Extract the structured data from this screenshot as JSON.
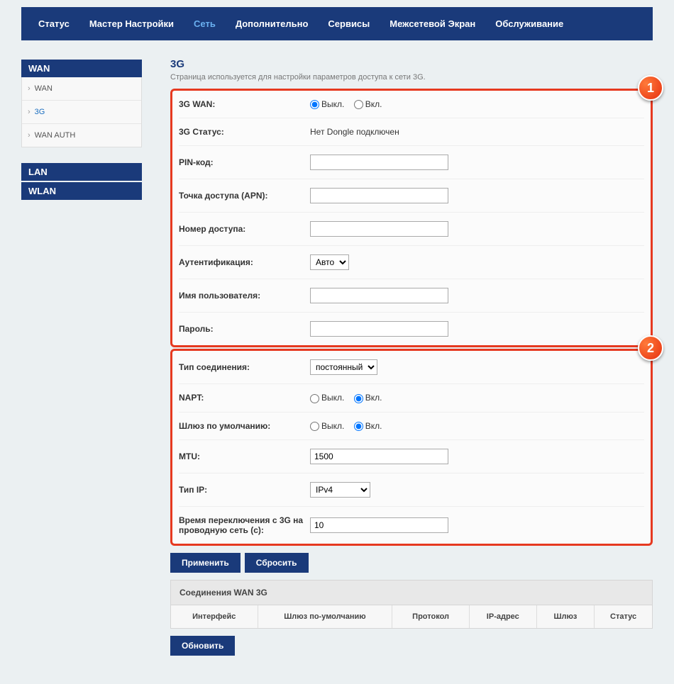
{
  "nav": {
    "items": [
      "Статус",
      "Мастер Настройки",
      "Сеть",
      "Дополнительно",
      "Сервисы",
      "Межсетевой Экран",
      "Обслуживание"
    ],
    "activeIndex": 2
  },
  "sidebar": {
    "groups": [
      {
        "title": "WAN",
        "items": [
          "WAN",
          "3G",
          "WAN AUTH"
        ],
        "activeIndex": 1
      },
      {
        "title": "LAN"
      },
      {
        "title": "WLAN"
      }
    ]
  },
  "page": {
    "title": "3G",
    "desc": "Страница используется для настройки параметров доступа к сети 3G."
  },
  "labels": {
    "wan3g": "3G WAN:",
    "status3g": "3G Статус:",
    "pin": "PIN-код:",
    "apn": "Точка доступа (APN):",
    "dialnum": "Номер доступа:",
    "auth": "Аутентификация:",
    "user": "Имя пользователя:",
    "pass": "Пароль:",
    "conntype": "Тип соединения:",
    "napt": "NAPT:",
    "defgw": "Шлюз по умолчанию:",
    "mtu": "MTU:",
    "iptype": "Тип IP:",
    "switchtime": "Время переключения с 3G на проводную сеть (с):"
  },
  "values": {
    "status3g": "Нет Dongle подключен",
    "radio_off": "Выкл.",
    "radio_on": "Вкл.",
    "pin": "",
    "apn": "",
    "dialnum": "",
    "auth": "Авто",
    "user": "",
    "pass": "",
    "conntype": "постоянный",
    "mtu": "1500",
    "iptype": "IPv4",
    "switchtime": "10"
  },
  "buttons": {
    "apply": "Применить",
    "reset": "Сбросить",
    "refresh": "Обновить"
  },
  "table": {
    "title": "Соединения WAN 3G",
    "headers": [
      "Интерфейс",
      "Шлюз по-умолчанию",
      "Протокол",
      "IP-адрес",
      "Шлюз",
      "Статус"
    ]
  },
  "markers": {
    "one": "1",
    "two": "2"
  }
}
